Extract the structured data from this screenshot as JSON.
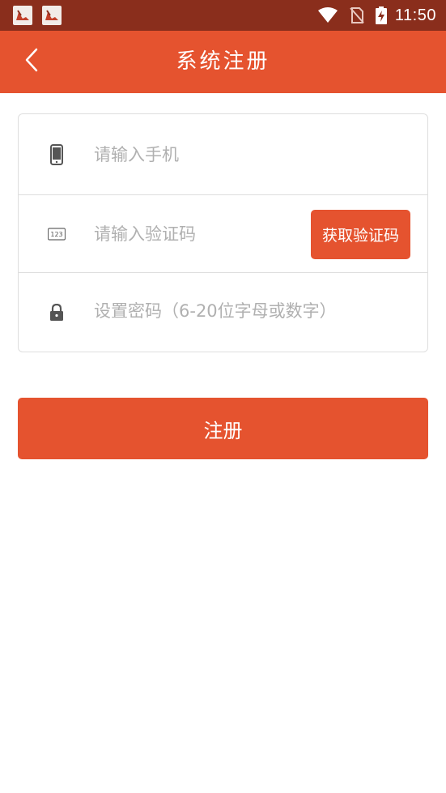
{
  "status_bar": {
    "time": "11:50",
    "notification_icons": [
      "app-notification-icon",
      "app-notification-icon"
    ],
    "icons": [
      "wifi-icon",
      "no-sim-icon",
      "battery-charging-icon"
    ]
  },
  "header": {
    "title": "系统注册",
    "back_icon": "chevron-left-icon"
  },
  "form": {
    "phone": {
      "icon": "phone-icon",
      "placeholder": "请输入手机",
      "value": ""
    },
    "code": {
      "icon": "keypad-icon",
      "placeholder": "请输入验证码",
      "value": "",
      "button_label": "获取验证码"
    },
    "password": {
      "icon": "lock-icon",
      "placeholder": "设置密码（6-20位字母或数字）",
      "value": ""
    }
  },
  "register_label": "注册",
  "colors": {
    "accent": "#e5532f",
    "status_bar": "#8a2e1c",
    "border": "#dedede",
    "placeholder": "#b0b0b0"
  }
}
